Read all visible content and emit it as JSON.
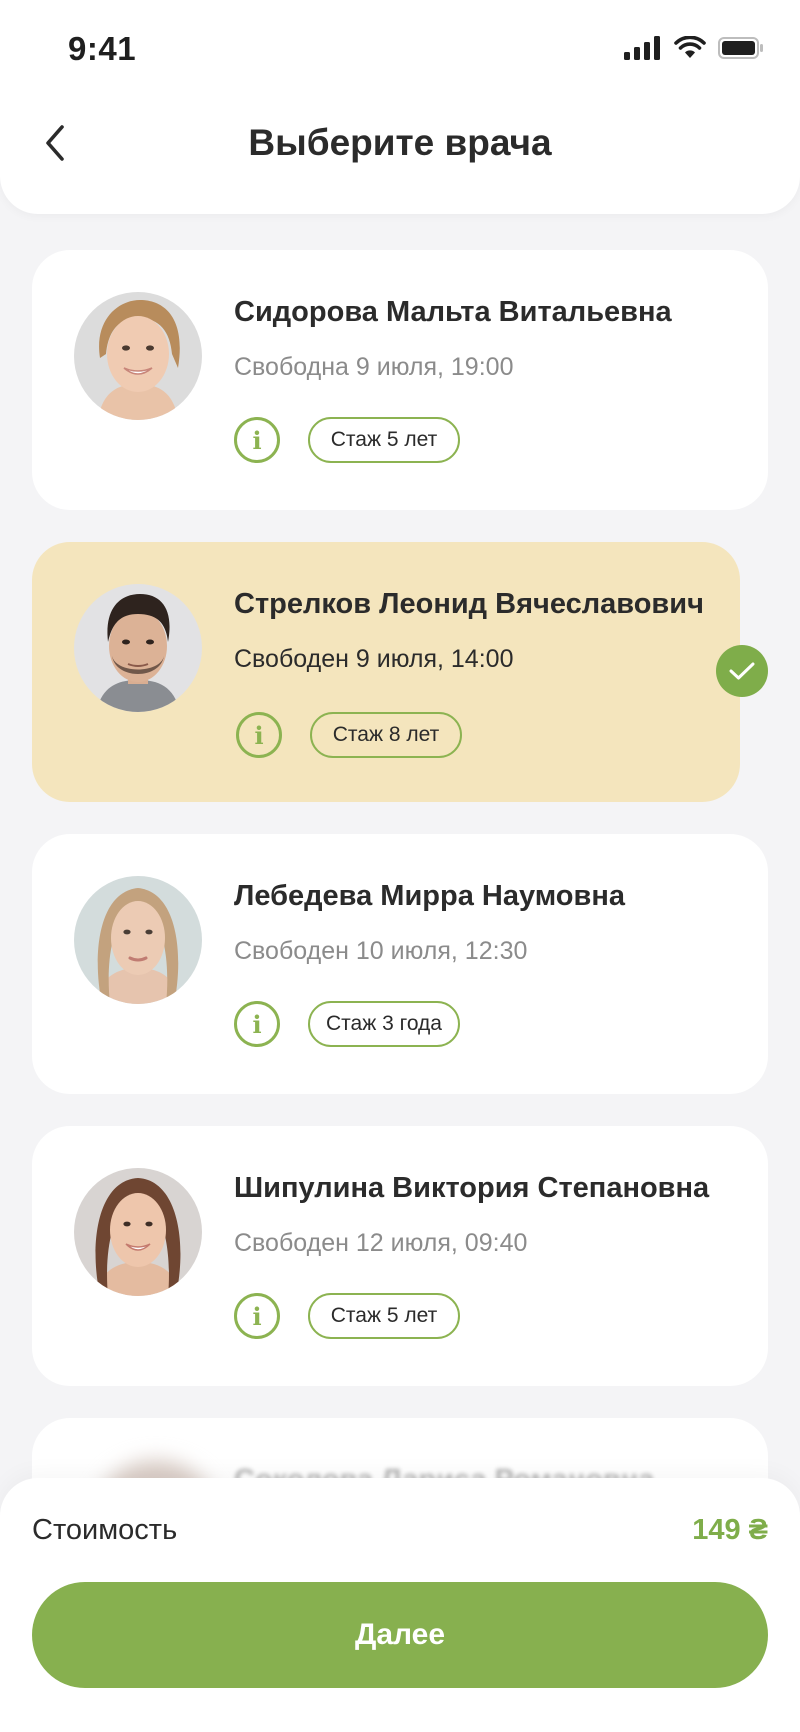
{
  "status_bar": {
    "time": "9:41",
    "icons": [
      "signal-icon",
      "wifi-icon",
      "battery-icon"
    ]
  },
  "header": {
    "title": "Выберите врача",
    "back_icon": "chevron-left-icon"
  },
  "doctors": [
    {
      "name": "Сидорова Мальта Витальевна",
      "slot": "Свободна 9 июля, 19:00",
      "experience": "Стаж 5 лет",
      "selected": false
    },
    {
      "name": "Стрелков Леонид Вячеславович",
      "slot": "Свободен 9 июля, 14:00",
      "experience": "Стаж 8 лет",
      "selected": true
    },
    {
      "name": "Лебедева Мирра Наумовна",
      "slot": "Свободен 10 июля, 12:30",
      "experience": "Стаж 3 года",
      "selected": false
    },
    {
      "name": "Шипулина Виктория Степановна",
      "slot": "Свободен 12 июля, 09:40",
      "experience": "Стаж 5 лет",
      "selected": false
    }
  ],
  "partial_doctor": {
    "name": "Соколова Лариса Романовна"
  },
  "info_glyph": "i",
  "footer": {
    "cost_label": "Стоимость",
    "cost_value": "149 ₴",
    "next_label": "Далее"
  },
  "colors": {
    "accent": "#87b04f",
    "selected_card": "#f4e5bd",
    "background": "#f4f4f6"
  }
}
